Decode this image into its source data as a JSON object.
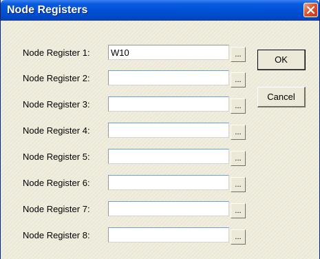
{
  "window": {
    "title": "Node Registers"
  },
  "registers": [
    {
      "label": "Node Register 1:",
      "value": "W10",
      "browse": "..."
    },
    {
      "label": "Node Register 2:",
      "value": "",
      "browse": "..."
    },
    {
      "label": "Node Register 3:",
      "value": "",
      "browse": "..."
    },
    {
      "label": "Node Register 4:",
      "value": "",
      "browse": "..."
    },
    {
      "label": "Node Register 5:",
      "value": "",
      "browse": "..."
    },
    {
      "label": "Node Register 6:",
      "value": "",
      "browse": "..."
    },
    {
      "label": "Node Register 7:",
      "value": "",
      "browse": "..."
    },
    {
      "label": "Node Register 8:",
      "value": "",
      "browse": "..."
    }
  ],
  "buttons": {
    "ok": "OK",
    "cancel": "Cancel"
  },
  "icons": {
    "close": "close-icon"
  },
  "colors": {
    "titlebar": "#0054e3",
    "close_button": "#e2542b",
    "dialog_background": "#ece9d8"
  }
}
